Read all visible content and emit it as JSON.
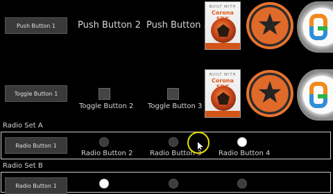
{
  "row1": {
    "push_button_1": "Push Button 1",
    "push_button_2": "Push Button 2",
    "push_button_3": "Push Button 3"
  },
  "row2": {
    "toggle_button_1": "Toggle Button 1",
    "toggle_button_2": "Toggle Button 2",
    "toggle_button_3": "Toggle Button 3"
  },
  "radio_set_a": {
    "title": "Radio Set A",
    "radio_button_1": "Radio Button 1",
    "radio_button_2": "Radio Button 2",
    "radio_button_3": "Radio Button 3",
    "radio_button_4": "Radio Button 4"
  },
  "radio_set_b": {
    "title": "Radio Set B",
    "radio_button_1": "Radio Button 1"
  },
  "book": {
    "top_text": "BUILT WITH",
    "title": "Corona SDK"
  },
  "icons": {
    "corona": "corona-logo-icon",
    "giftiz": "giftiz-logo-icon"
  },
  "colors": {
    "background": "#000000",
    "button_fill": "#3a3a3a",
    "accent_orange": "#e06a2a",
    "cursor_ring": "#e8e200"
  }
}
